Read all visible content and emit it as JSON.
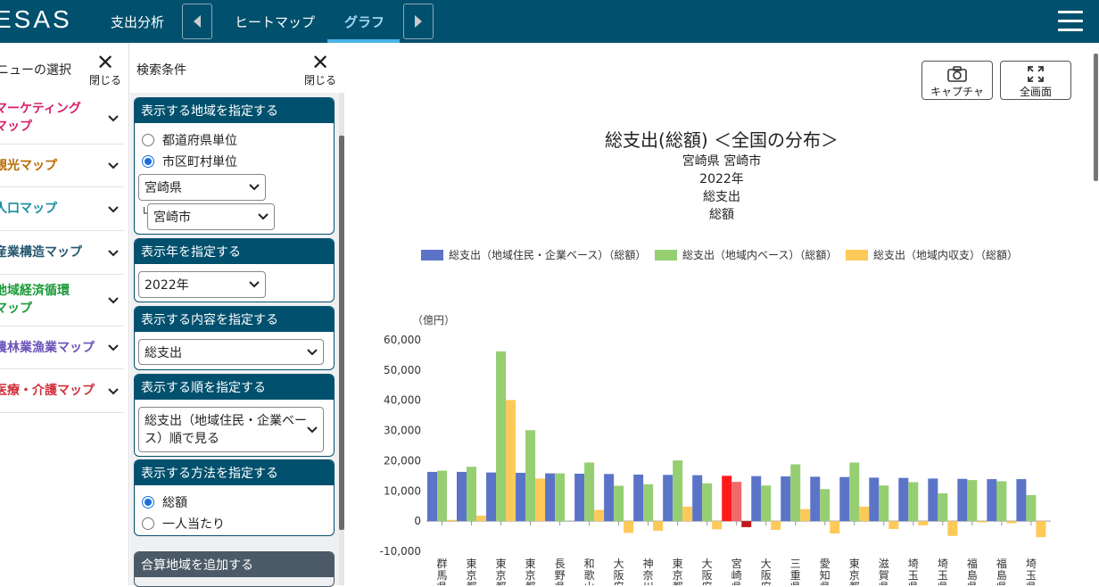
{
  "header": {
    "logo": "ESAS",
    "nav_expense": "支出分析",
    "tab_heatmap": "ヒートマップ",
    "tab_graph": "グラフ"
  },
  "menu": {
    "title": "ニューの選択",
    "close_label": "閉じる",
    "items": [
      {
        "label1": "マーケティング",
        "label2": "マップ",
        "color": "#d6216b"
      },
      {
        "label1": "観光マップ",
        "label2": "",
        "color": "#b86a00"
      },
      {
        "label1": "人口マップ",
        "label2": "",
        "color": "#1a8ea0"
      },
      {
        "label1": "産業構造マップ",
        "label2": "",
        "color": "#24566e"
      },
      {
        "label1": "地域経済循環",
        "label2": "マップ",
        "color": "#1a9a3a"
      },
      {
        "label1": "農林業漁業マップ",
        "label2": "",
        "color": "#6a52b8"
      },
      {
        "label1": "医療・介護マップ",
        "label2": "",
        "color": "#d0303a"
      }
    ]
  },
  "conditions": {
    "title": "検索条件",
    "close_label": "閉じる",
    "region": {
      "header": "表示する地域を指定する",
      "opt_pref": "都道府県単位",
      "opt_city": "市区町村単位",
      "pref_value": "宮崎県",
      "city_prefix": "└",
      "city_value": "宮崎市"
    },
    "year": {
      "header": "表示年を指定する",
      "value": "2022年"
    },
    "content": {
      "header": "表示する内容を指定する",
      "value": "総支出"
    },
    "order": {
      "header": "表示する順を指定する",
      "value_line1": "総支出（地域住民・企業ベー",
      "value_line2": "ス）順で見る"
    },
    "method": {
      "header": "表示する方法を指定する",
      "opt_total": "総額",
      "opt_per_capita": "一人当たり"
    },
    "add_region": {
      "header": "合算地域を追加する"
    }
  },
  "toolbar": {
    "capture": "キャプチャ",
    "fullscreen": "全画面"
  },
  "colors": {
    "blue": "#5b74c8",
    "green": "#96cf72",
    "yellow": "#fdc959",
    "highlight": "#ff1a1a",
    "highlight2": "#f06a6a",
    "highlight3": "#c0181e"
  },
  "chart_data": {
    "type": "bar",
    "title": "総支出(総額) ＜全国の分布＞",
    "subtitle_lines": [
      "宮崎県 宮崎市",
      "2022年",
      "総支出",
      "総額"
    ],
    "ylabel": "（億円）",
    "ylim": [
      -10000,
      60000
    ],
    "yticks": [
      60000,
      50000,
      40000,
      30000,
      20000,
      10000,
      0,
      -10000
    ],
    "ytick_labels": [
      "60,000",
      "50,000",
      "40,000",
      "30,000",
      "20,000",
      "10,000",
      "0",
      "-10,000"
    ],
    "legend": [
      "総支出（地域住民・企業ベース）（総額）",
      "総支出（地域内ベース）（総額）",
      "総支出（地域内収支）（総額）"
    ],
    "highlight_index": 10,
    "categories": [
      "群馬県",
      "東京都",
      "東京都",
      "東京都",
      "長野県",
      "和歌山",
      "大阪府",
      "神奈川",
      "東京都",
      "大阪府",
      "宮崎県",
      "大阪府",
      "三重県",
      "愛知県",
      "東京都",
      "滋賀県",
      "埼玉県",
      "埼玉県",
      "福島県",
      "福島県",
      "埼玉県"
    ],
    "series": [
      {
        "name": "総支出（地域住民・企業ベース）（総額）",
        "values": [
          16300,
          16300,
          16100,
          16000,
          15800,
          15700,
          15600,
          15400,
          15300,
          15200,
          15000,
          14900,
          14800,
          14700,
          14600,
          14400,
          14300,
          14100,
          14000,
          13900,
          13900
        ]
      },
      {
        "name": "総支出（地域内ベース）（総額）",
        "values": [
          16700,
          18000,
          56200,
          30100,
          15800,
          19400,
          11700,
          12200,
          20100,
          12500,
          13000,
          11800,
          18800,
          10600,
          19400,
          11800,
          12900,
          9200,
          13600,
          13200,
          8600
        ]
      },
      {
        "name": "総支出（地域内収支）（総額）",
        "values": [
          400,
          1800,
          40100,
          14100,
          0,
          3700,
          -3900,
          -3200,
          4800,
          -2700,
          -2000,
          -2900,
          4000,
          -4100,
          4800,
          -2600,
          -1400,
          -4900,
          -400,
          -700,
          -5300
        ]
      }
    ]
  }
}
